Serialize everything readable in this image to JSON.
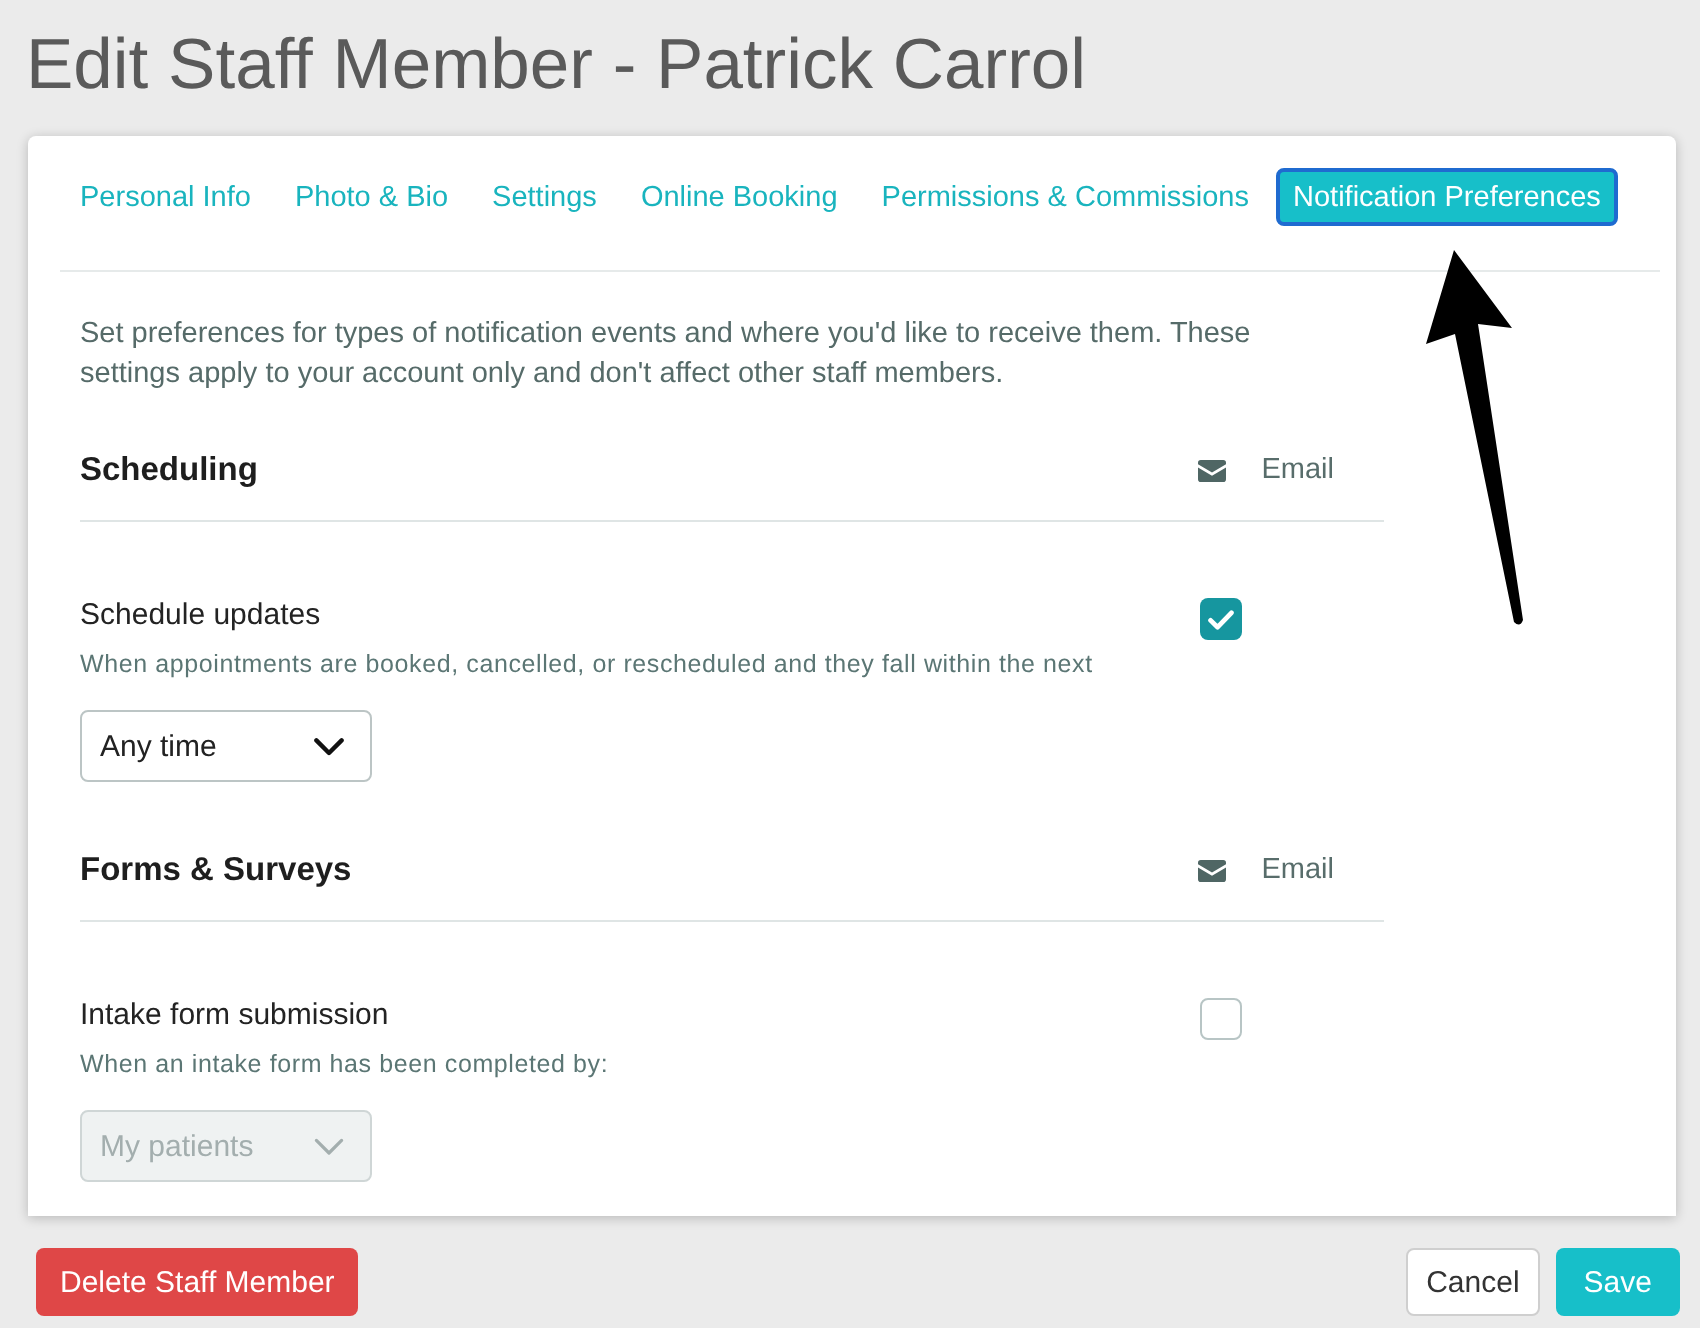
{
  "page": {
    "title": "Edit Staff Member - Patrick Carrol"
  },
  "tabs": [
    {
      "label": "Personal Info",
      "selected": false
    },
    {
      "label": "Photo & Bio",
      "selected": false
    },
    {
      "label": "Settings",
      "selected": false
    },
    {
      "label": "Online Booking",
      "selected": false
    },
    {
      "label": "Permissions & Commissions",
      "selected": false
    },
    {
      "label": "Notification Preferences",
      "selected": true
    }
  ],
  "intro": "Set preferences for types of notification events and where you'd like to receive them. These settings apply to your account only and don't affect other staff members.",
  "sections": [
    {
      "title": "Scheduling",
      "channel": "Email",
      "items": [
        {
          "label": "Schedule updates",
          "description": "When appointments are booked, cancelled, or rescheduled and they fall within the next",
          "checked": true,
          "dropdown": {
            "value": "Any time",
            "disabled": false
          }
        }
      ]
    },
    {
      "title": "Forms & Surveys",
      "channel": "Email",
      "items": [
        {
          "label": "Intake form submission",
          "description": "When an intake form has been completed by:",
          "checked": false,
          "dropdown": {
            "value": "My patients",
            "disabled": true
          }
        }
      ]
    }
  ],
  "footer": {
    "delete_button": "Delete Staff Member",
    "cancel_button": "Cancel",
    "save_button": "Save"
  }
}
